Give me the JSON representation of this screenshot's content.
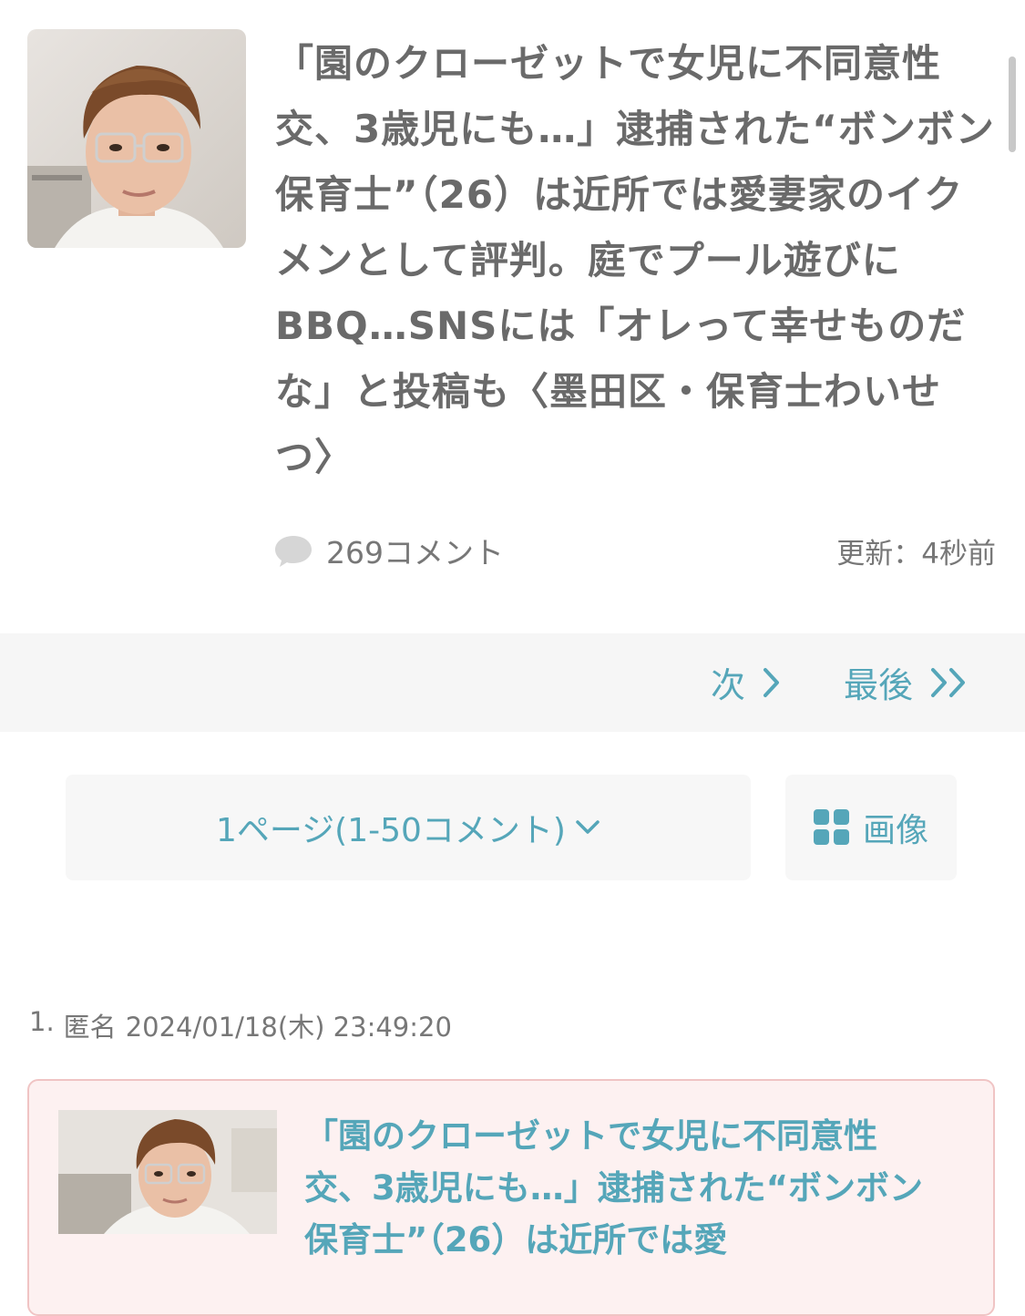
{
  "article": {
    "title": "「園のクローゼットで女児に不同意性交、3歳児にも…」逮捕された“ボンボン保育士”（26）は近所では愛妻家のイクメンとして評判。庭でプール遊びにBBQ…SNSには「オレって幸せものだな」と投稿も〈墨田区・保育士わいせつ〉",
    "comment_count": "269コメント",
    "updated": "更新：4秒前",
    "thumbnail_icon": "person-photo-icon"
  },
  "pager": {
    "next_label": "次",
    "last_label": "最後"
  },
  "controls": {
    "page_select_label": "1ページ(1-50コメント)",
    "image_button_label": "画像"
  },
  "comment": {
    "number": "1.",
    "author": "匿名",
    "datetime": "2024/01/18(木) 23:49:20",
    "embed_title": "「園のクローゼットで女児に不同意性交、3歳児にも…」逮捕された“ボンボン保育士”（26）は近所では愛"
  },
  "colors": {
    "accent": "#55a6b9",
    "title_gray": "#6a6a6a",
    "pager_bg": "#f6f6f6",
    "card_bg": "#fdf1f1",
    "card_border": "#f0c4c4"
  }
}
